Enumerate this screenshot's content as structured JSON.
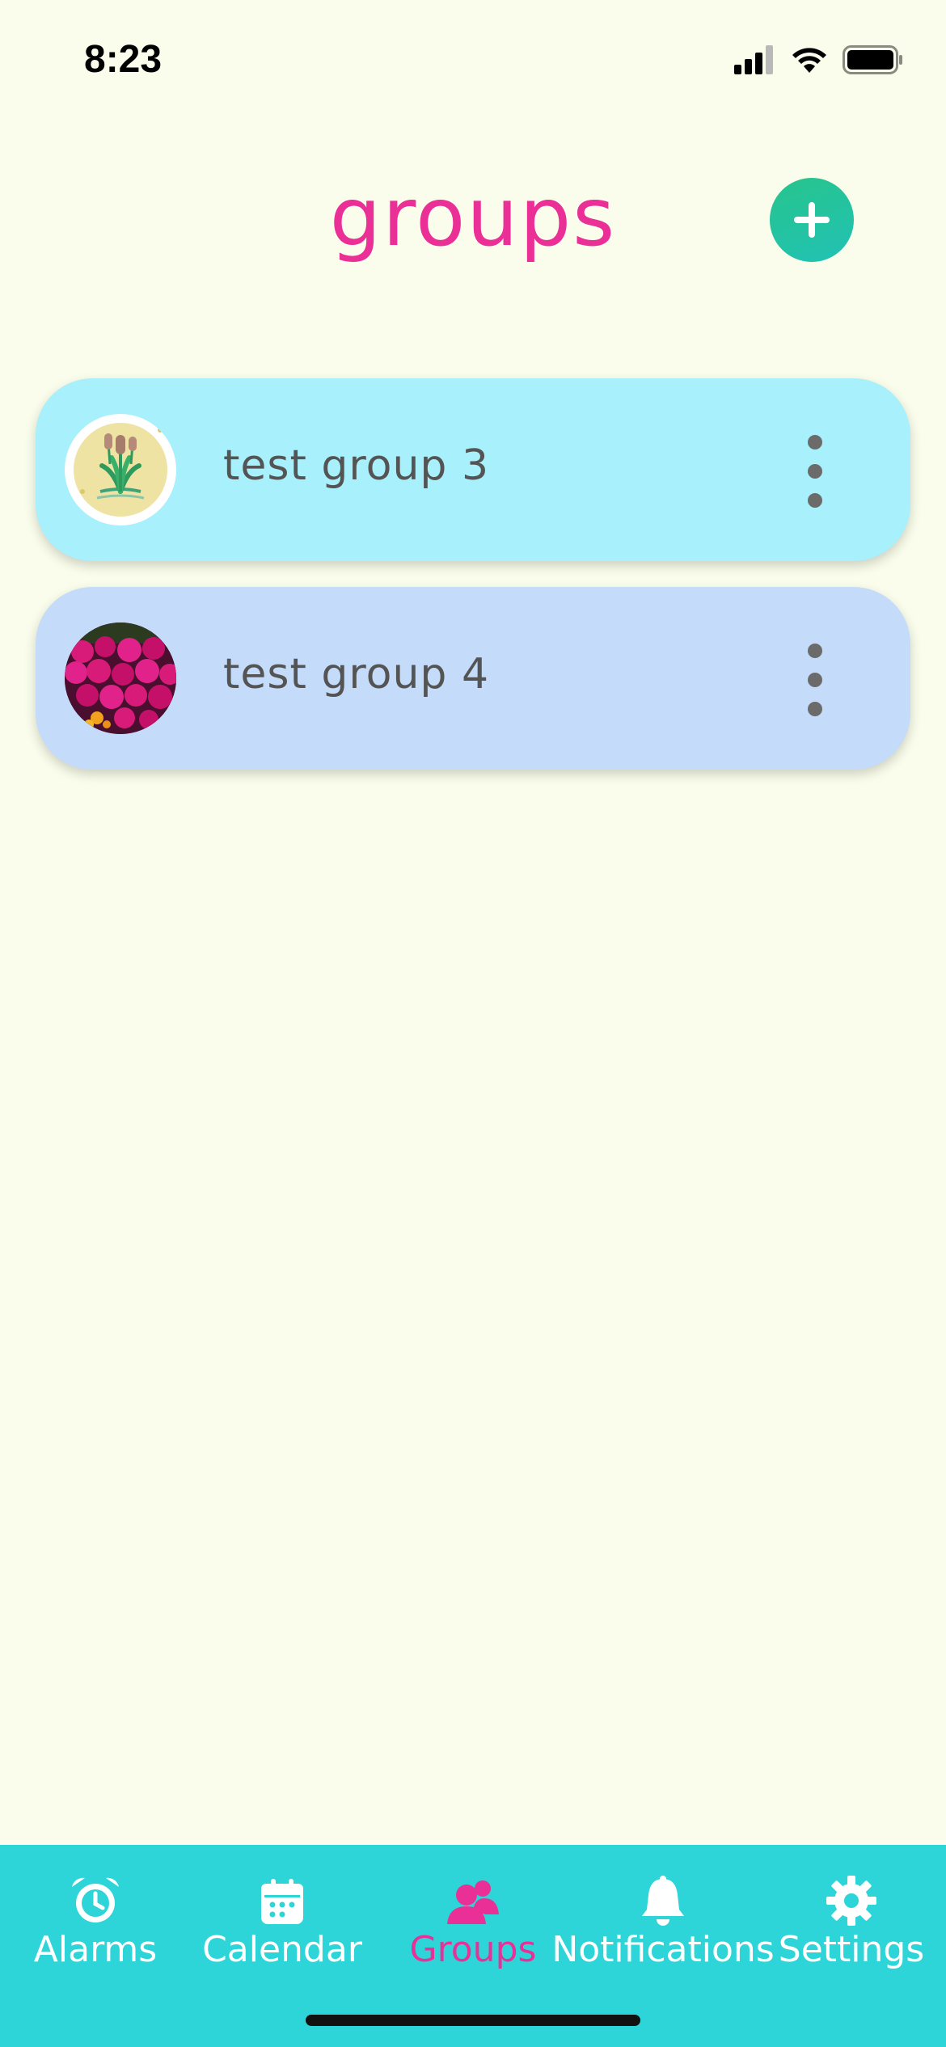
{
  "status_bar": {
    "time": "8:23"
  },
  "header": {
    "title": "groups",
    "add_icon": "plus-icon"
  },
  "groups": [
    {
      "name": "test group 3",
      "avatar": "cattail-illustration",
      "card_color": "#a8f0fb"
    },
    {
      "name": "test group 4",
      "avatar": "pink-flowers-photo",
      "card_color": "#c4dbfa"
    }
  ],
  "tab_bar": {
    "tabs": [
      {
        "label": "Alarms",
        "icon": "alarm-clock-icon"
      },
      {
        "label": "Calendar",
        "icon": "calendar-icon"
      },
      {
        "label": "Groups",
        "icon": "people-icon",
        "active": true
      },
      {
        "label": "Notifications",
        "icon": "bell-icon"
      },
      {
        "label": "Settings",
        "icon": "gear-icon"
      }
    ]
  },
  "colors": {
    "background": "#fafdeb",
    "accent": "#ea2f96",
    "tab_bar": "#2ed5d8",
    "add_button": "#21c2a0"
  }
}
